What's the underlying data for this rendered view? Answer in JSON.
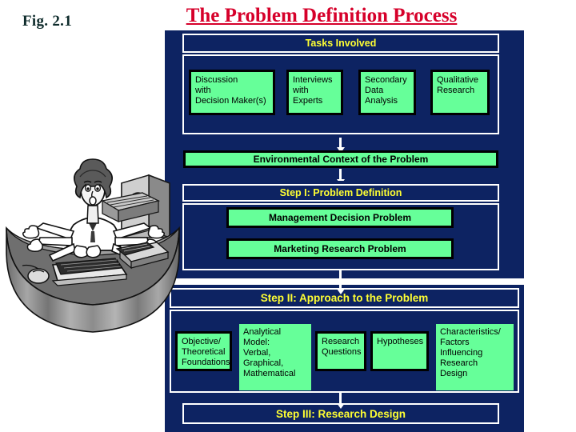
{
  "figure": {
    "label": "Fig. 2.1",
    "title": "The Problem Definition Process"
  },
  "colors": {
    "panel_navy": "#0d2362",
    "box_green": "#66ff99",
    "band_text_yellow": "#ffff33",
    "title_red": "#d6002a",
    "border_black": "#000000",
    "border_white": "#ffffff"
  },
  "sections": {
    "tasks": {
      "heading": "Tasks Involved",
      "boxes": [
        {
          "text": "Discussion\nwith\nDecision Maker(s)"
        },
        {
          "text": "Interviews\nwith\nExperts"
        },
        {
          "text": "Secondary\nData\nAnalysis"
        },
        {
          "text": "Qualitative\nResearch"
        }
      ]
    },
    "environment": {
      "label": "Environmental Context of the Problem"
    },
    "step1": {
      "heading": "Step I: Problem Definition",
      "boxes": [
        {
          "text": "Management Decision Problem"
        },
        {
          "text": "Marketing Research Problem"
        }
      ]
    },
    "step2": {
      "heading": "Step II:  Approach to the Problem",
      "boxes": [
        {
          "text": "Objective/\nTheoretical\nFoundations"
        },
        {
          "text": "Analytical\nModel:\nVerbal,\nGraphical,\nMathematical"
        },
        {
          "text": "Research\nQuestions"
        },
        {
          "text": "Hypotheses"
        },
        {
          "text": "Characteristics/\nFactors\nInfluencing\nResearch\nDesign"
        }
      ]
    },
    "step3": {
      "heading": "Step III: Research Design"
    }
  },
  "illustration": {
    "name": "busy-multitasking-person-at-desk-clipart",
    "description": "Grayscale cartoon of a person with many arms working at a curved desk with keyboard, computer and filing cabinet"
  }
}
